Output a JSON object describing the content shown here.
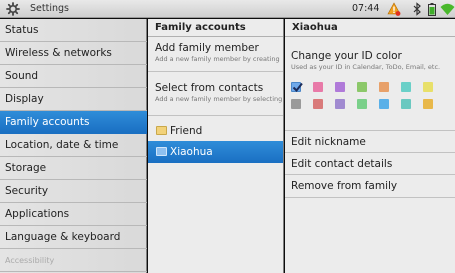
{
  "statusbar": {
    "title": "Settings",
    "time": "07:44",
    "icons": [
      "settings-app-icon",
      "warning-icon",
      "bluetooth-icon",
      "battery-icon",
      "wifi-icon"
    ]
  },
  "nav": {
    "items": [
      {
        "label": "Status"
      },
      {
        "label": "Wireless & networks"
      },
      {
        "label": "Sound"
      },
      {
        "label": "Display"
      },
      {
        "label": "Family accounts",
        "selected": true
      },
      {
        "label": "Location, date & time"
      },
      {
        "label": "Storage"
      },
      {
        "label": "Security"
      },
      {
        "label": "Applications"
      },
      {
        "label": "Language & keyboard"
      },
      {
        "label": "Accessibility"
      }
    ]
  },
  "family": {
    "header": "Family accounts",
    "add_title": "Add family member",
    "add_sub": "Add a new family member by creating",
    "select_title": "Select from contacts",
    "select_sub": "Add a new family member by selecting",
    "contacts": [
      {
        "name": "Friend",
        "color": "#f2d27a"
      },
      {
        "name": "Xiaohua",
        "color": "#6fa9ea",
        "selected": true
      }
    ]
  },
  "detail": {
    "header": "Xiaohua",
    "color_title": "Change your ID color",
    "color_sub": "Used as your ID in Calendar, ToDo, Email, etc.",
    "color_swatches_row1": [
      "#6fa9ea",
      "#e87aa8",
      "#b07ad9",
      "#8cc86a",
      "#e8a16a",
      "#6ad0c8",
      "#e8e06a"
    ],
    "color_swatches_row2": [
      "#9a9a9a",
      "#d97a7a",
      "#a08ad0",
      "#7ad08a",
      "#5ab0e8",
      "#6ac8c0",
      "#e8b84a"
    ],
    "selected_color_index": 0,
    "edit_nickname": "Edit nickname",
    "edit_contact": "Edit contact details",
    "remove": "Remove from family"
  }
}
